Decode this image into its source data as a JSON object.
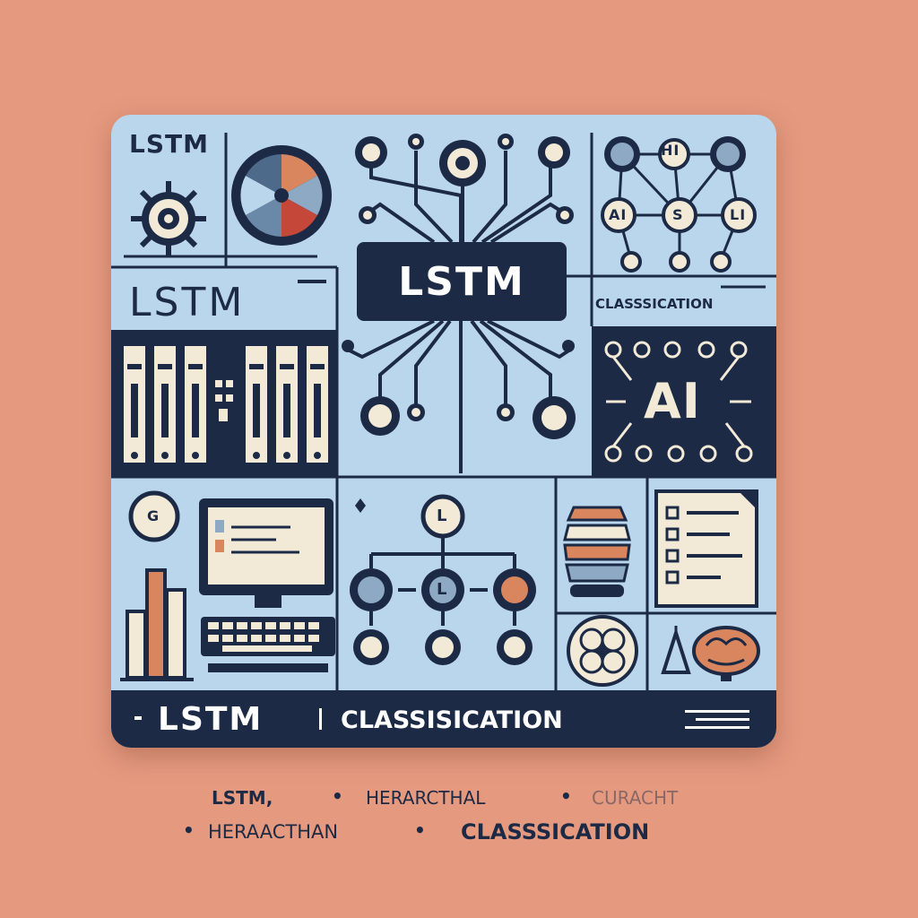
{
  "card": {
    "title_top_left": "LSTM",
    "title_left_large": "LSTM",
    "center_badge": "LSTM",
    "net_labels": [
      "HI",
      "AI",
      "S",
      "LI"
    ],
    "classification_label": "CLASSSICATION",
    "ai_label": "AI",
    "gear_circle_label": "G",
    "tree_node_labels": [
      "L",
      "L"
    ],
    "footer": {
      "left_text": "LSTM",
      "right_text": "CLASSISICATION"
    }
  },
  "caption": {
    "line1": [
      "LSTM,",
      "HERARCTHAL",
      "CURACHT"
    ],
    "line2": [
      "HERAACTHAN",
      "CLASSSICATION"
    ]
  },
  "colors": {
    "background": "#e59a7f",
    "card": "#b9d6ec",
    "navy": "#1c2a45",
    "cream": "#f2ead7"
  }
}
